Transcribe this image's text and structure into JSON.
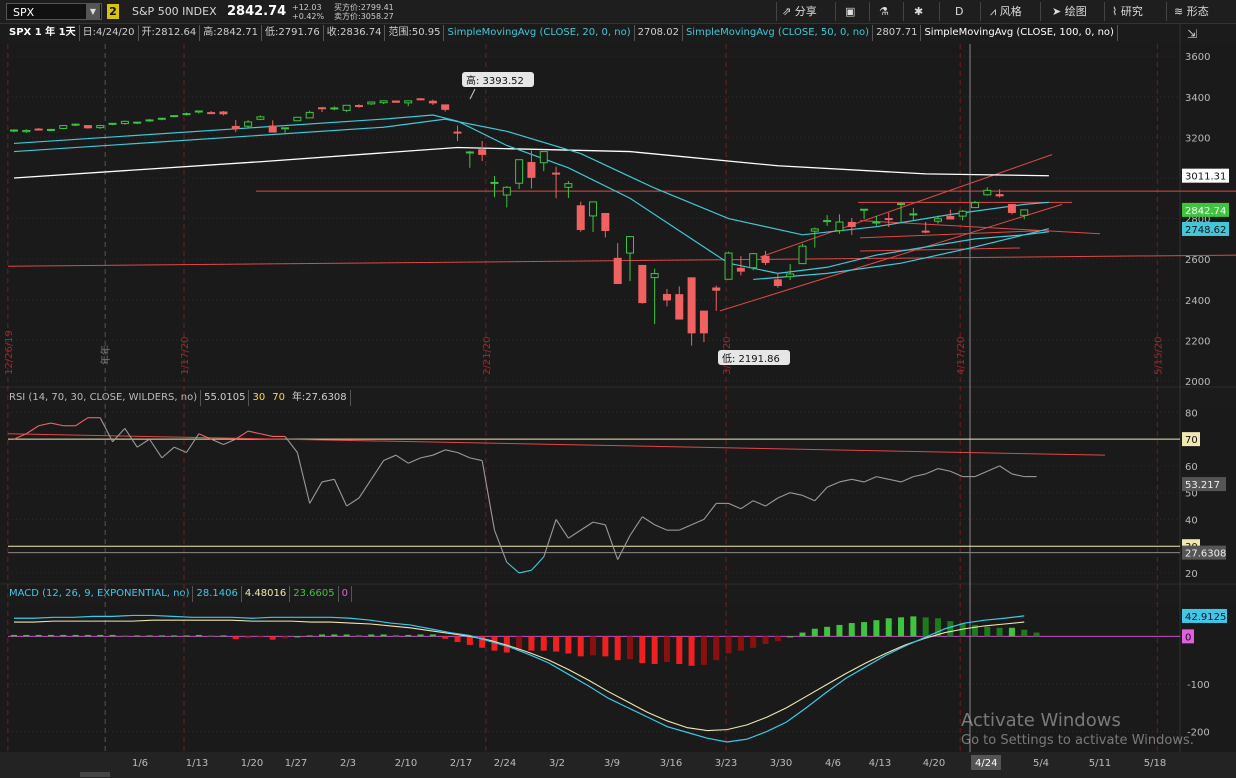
{
  "toolbar": {
    "symbol": "SPX",
    "link_badge": "2",
    "name": "S&P 500 INDEX",
    "last": "2842.74",
    "change": "+12.03",
    "change_pct": "+0.42%",
    "bid": "买方价:2799.41",
    "ask": "卖方价:3058.27",
    "share": "分享",
    "period": "D",
    "style": "风格",
    "drawing": "绘图",
    "studies": "研究",
    "patterns": "形态"
  },
  "infobar": {
    "title": "SPX 1 年 1天",
    "date": "日:4/24/20",
    "open": "开:2812.64",
    "high": "高:2842.71",
    "low": "低:2791.76",
    "close": "收:2836.74",
    "range": "范围:50.95",
    "sma20_label": "SimpleMovingAvg (CLOSE, 20, 0, no)",
    "sma20_value": "2708.02",
    "sma50_label": "SimpleMovingAvg (CLOSE, 50, 0, no)",
    "sma50_value": "2807.71",
    "sma100_label": "SimpleMovingAvg (CLOSE, 100, 0, no)"
  },
  "rsi_bar": {
    "label": "RSI (14, 70, 30, CLOSE, WILDERS, no)",
    "value": "55.0105",
    "os": "30",
    "ob": "70",
    "year": "年:27.6308"
  },
  "macd_bar": {
    "label": "MACD (12, 26, 9, EXPONENTIAL, no)",
    "value": "28.1406",
    "avg": "4.48016",
    "diff": "23.6605",
    "zero": "0"
  },
  "colors": {
    "bg": "#1b1b1b",
    "up": "#3ec43e",
    "down": "#f06262",
    "sma_cyan": "#40c8d8",
    "sma_white": "#ffffff",
    "trend": "#e04848",
    "rsi": "#9a9a9a",
    "macd": "#3ec8e8",
    "macd_avg": "#f0e8b0"
  },
  "watermark": {
    "line1": "Activate Windows",
    "line2": "Go to Settings to activate Windows."
  },
  "chart_data": [
    {
      "type": "candlestick",
      "title": "SPX 1 年 1天",
      "y_ticks": [
        2000,
        2200,
        2400,
        2600,
        2800,
        3000,
        3200,
        3400,
        3600
      ],
      "ylim": [
        1980,
        3660
      ],
      "x_tick_labels": [
        "1/6",
        "1/13",
        "1/20",
        "1/27",
        "2/3",
        "2/10",
        "2/17",
        "2/24",
        "3/2",
        "3/9",
        "3/16",
        "3/23",
        "3/30",
        "4/6",
        "4/13",
        "4/20",
        "4/24",
        "5/4",
        "5/11",
        "5/18"
      ],
      "vertical_date_labels": [
        "12/26/19",
        "1/17/20",
        "2/21/20",
        "3/20/20",
        "4/17/20",
        "5/15/20"
      ],
      "year_marker": "年年",
      "high_callout": "高: 3393.52",
      "low_callout": "低: 2191.86",
      "price_labels": [
        {
          "value": "3011.31",
          "y": 3011.31,
          "color": "#ffffff"
        },
        {
          "value": "2842.74",
          "y": 2842.74,
          "color": "#3ec43e"
        },
        {
          "value": "2748.62",
          "y": 2748.62,
          "color": "#40c8d8"
        }
      ],
      "candles": [
        [
          3235,
          3240,
          3225,
          3236
        ],
        [
          3228,
          3240,
          3222,
          3234
        ],
        [
          3241,
          3246,
          3234,
          3239
        ],
        [
          3239,
          3243,
          3233,
          3239
        ],
        [
          3244,
          3261,
          3240,
          3258
        ],
        [
          3262,
          3268,
          3255,
          3265
        ],
        [
          3258,
          3260,
          3243,
          3247
        ],
        [
          3248,
          3262,
          3242,
          3258
        ],
        [
          3267,
          3271,
          3260,
          3269
        ],
        [
          3268,
          3283,
          3262,
          3279
        ],
        [
          3274,
          3277,
          3265,
          3275
        ],
        [
          3285,
          3290,
          3277,
          3286
        ],
        [
          3294,
          3297,
          3284,
          3294
        ],
        [
          3304,
          3310,
          3300,
          3307
        ],
        [
          3316,
          3322,
          3308,
          3317
        ],
        [
          3325,
          3331,
          3317,
          3330
        ],
        [
          3322,
          3330,
          3315,
          3321
        ],
        [
          3325,
          3330,
          3308,
          3316
        ],
        [
          3254,
          3286,
          3226,
          3244
        ],
        [
          3255,
          3285,
          3248,
          3276
        ],
        [
          3289,
          3308,
          3285,
          3301
        ],
        [
          3256,
          3284,
          3226,
          3226
        ],
        [
          3242,
          3248,
          3214,
          3247
        ],
        [
          3282,
          3301,
          3280,
          3299
        ],
        [
          3296,
          3331,
          3296,
          3323
        ],
        [
          3346,
          3350,
          3325,
          3345
        ],
        [
          3344,
          3353,
          3334,
          3345
        ],
        [
          3333,
          3358,
          3324,
          3358
        ],
        [
          3357,
          3363,
          3346,
          3352
        ],
        [
          3365,
          3377,
          3360,
          3374
        ],
        [
          3371,
          3380,
          3364,
          3380
        ],
        [
          3379,
          3381,
          3371,
          3373
        ],
        [
          3370,
          3381,
          3354,
          3380
        ],
        [
          3390,
          3393,
          3382,
          3386
        ],
        [
          3378,
          3386,
          3360,
          3370
        ],
        [
          3360,
          3360,
          3327,
          3338
        ],
        [
          3226,
          3258,
          3182,
          3225
        ],
        [
          3128,
          3133,
          3050,
          3128
        ],
        [
          3139,
          3182,
          3084,
          3116
        ],
        [
          2978,
          3010,
          2906,
          2978
        ],
        [
          2916,
          2960,
          2855,
          2954
        ],
        [
          2974,
          3090,
          2946,
          3090
        ],
        [
          3076,
          3136,
          2948,
          3003
        ],
        [
          3075,
          3130,
          3034,
          3130
        ],
        [
          3024,
          3055,
          2900,
          3023
        ],
        [
          2954,
          2985,
          2901,
          2972
        ],
        [
          2863,
          2883,
          2735,
          2746
        ],
        [
          2813,
          2882,
          2734,
          2882
        ],
        [
          2825,
          2825,
          2707,
          2741
        ],
        [
          2604,
          2679,
          2478,
          2480
        ],
        [
          2630,
          2712,
          2492,
          2711
        ],
        [
          2569,
          2569,
          2381,
          2386
        ],
        [
          2509,
          2553,
          2280,
          2529
        ],
        [
          2426,
          2453,
          2367,
          2399
        ],
        [
          2425,
          2466,
          2319,
          2305
        ],
        [
          2508,
          2508,
          2174,
          2237
        ],
        [
          2344,
          2344,
          2191,
          2237
        ],
        [
          2458,
          2470,
          2345,
          2447
        ],
        [
          2501,
          2637,
          2501,
          2630
        ],
        [
          2555,
          2615,
          2520,
          2541
        ],
        [
          2558,
          2631,
          2545,
          2627
        ],
        [
          2614,
          2641,
          2571,
          2584
        ],
        [
          2498,
          2533,
          2459,
          2470
        ],
        [
          2514,
          2576,
          2497,
          2527
        ],
        [
          2578,
          2676,
          2578,
          2664
        ],
        [
          2738,
          2756,
          2657,
          2749
        ],
        [
          2785,
          2817,
          2764,
          2790
        ],
        [
          2741,
          2821,
          2725,
          2783
        ],
        [
          2781,
          2803,
          2719,
          2761
        ],
        [
          2842,
          2847,
          2797,
          2846
        ],
        [
          2780,
          2813,
          2764,
          2783
        ],
        [
          2800,
          2829,
          2758,
          2799
        ],
        [
          2869,
          2879,
          2776,
          2874
        ],
        [
          2823,
          2852,
          2793,
          2823
        ],
        [
          2738,
          2783,
          2727,
          2736
        ],
        [
          2787,
          2815,
          2775,
          2799
        ],
        [
          2810,
          2844,
          2798,
          2798
        ],
        [
          2812,
          2842,
          2791,
          2836
        ],
        [
          2854,
          2887,
          2852,
          2878
        ],
        [
          2917,
          2954,
          2912,
          2939
        ],
        [
          2918,
          2944,
          2904,
          2912
        ],
        [
          2869,
          2869,
          2821,
          2830
        ],
        [
          2816,
          2844,
          2797,
          2843
        ]
      ],
      "sma20_cyan": [
        [
          0,
          3170
        ],
        [
          30,
          3290
        ],
        [
          34,
          3310
        ],
        [
          36,
          3280
        ],
        [
          40,
          3160
        ],
        [
          45,
          3050
        ],
        [
          50,
          2900
        ],
        [
          55,
          2700
        ],
        [
          58,
          2580
        ],
        [
          62,
          2530
        ],
        [
          66,
          2560
        ],
        [
          70,
          2620
        ],
        [
          74,
          2660
        ],
        [
          78,
          2700
        ],
        [
          82,
          2720
        ],
        [
          84,
          2735
        ]
      ],
      "sma50_cyan": [
        [
          0,
          3130
        ],
        [
          30,
          3250
        ],
        [
          35,
          3290
        ],
        [
          40,
          3230
        ],
        [
          46,
          3120
        ],
        [
          52,
          2950
        ],
        [
          58,
          2800
        ],
        [
          64,
          2720
        ],
        [
          70,
          2760
        ],
        [
          76,
          2820
        ],
        [
          82,
          2870
        ],
        [
          84,
          2880
        ]
      ],
      "sma100_white": [
        [
          0,
          3000
        ],
        [
          20,
          3080
        ],
        [
          36,
          3150
        ],
        [
          50,
          3130
        ],
        [
          62,
          3060
        ],
        [
          74,
          3020
        ],
        [
          84,
          3011
        ]
      ],
      "sma_low_cyan": [
        [
          60,
          2500
        ],
        [
          66,
          2530
        ],
        [
          72,
          2580
        ],
        [
          78,
          2660
        ],
        [
          82,
          2720
        ],
        [
          84,
          2750
        ]
      ]
    },
    {
      "type": "line",
      "title": "RSI (14, 70, 30, CLOSE, WILDERS, no)",
      "y_ticks": [
        20,
        30,
        40,
        50,
        60,
        70,
        80
      ],
      "ylim": [
        17,
        82
      ],
      "price_labels": [
        {
          "value": "70",
          "y": 70
        },
        {
          "value": "53.217",
          "y": 53.2
        },
        {
          "value": "30",
          "y": 30
        },
        {
          "value": "27.6308",
          "y": 27.6
        }
      ],
      "values": [
        70,
        72,
        75,
        76,
        75,
        75,
        78,
        78,
        69,
        74,
        67,
        70,
        63,
        67,
        65,
        72,
        70,
        68,
        70,
        73,
        72,
        71,
        71,
        65,
        46,
        54,
        55,
        45,
        48,
        55,
        62,
        64,
        61,
        63,
        64,
        66,
        65,
        63,
        62,
        36,
        24,
        20,
        21,
        26,
        40,
        33,
        36,
        39,
        38,
        25,
        34,
        41,
        38,
        36,
        36,
        38,
        40,
        46,
        46,
        44,
        47,
        45,
        48,
        50,
        49,
        47,
        52,
        54,
        55,
        54,
        56,
        55,
        54,
        56,
        57,
        59,
        58,
        56,
        56,
        58,
        60,
        57,
        56,
        56
      ],
      "series": [
        {
          "name": "RSI",
          "values": "values"
        }
      ]
    },
    {
      "type": "bar+line",
      "title": "MACD (12, 26, 9, EXPONENTIAL, no)",
      "y_ticks": [
        -200,
        -100,
        0
      ],
      "ylim": [
        -243,
        68
      ],
      "price_labels": [
        {
          "value": "42.9125",
          "y": 42.9
        },
        {
          "value": "0",
          "y": 0
        }
      ],
      "histogram": [
        3,
        3,
        3,
        3,
        3,
        3,
        3,
        3,
        3,
        2,
        2,
        2,
        2,
        2,
        2,
        3,
        2,
        2,
        -6,
        -4,
        -2,
        -7,
        -4,
        0,
        2,
        4,
        4,
        4,
        3,
        4,
        4,
        3,
        3,
        4,
        4,
        -5,
        -12,
        -18,
        -24,
        -30,
        -34,
        -30,
        -30,
        -30,
        -32,
        -36,
        -42,
        -40,
        -42,
        -50,
        -48,
        -56,
        -58,
        -54,
        -58,
        -62,
        -60,
        -50,
        -36,
        -30,
        -24,
        -16,
        -10,
        0,
        8,
        16,
        20,
        24,
        28,
        30,
        34,
        38,
        40,
        42,
        40,
        38,
        32,
        28,
        24,
        20,
        18,
        18,
        14,
        8
      ],
      "macd_line": [
        38,
        38,
        40,
        40,
        42,
        42,
        44,
        44,
        42,
        40,
        40,
        40,
        38,
        40,
        40,
        40,
        40,
        38,
        34,
        28,
        24,
        16,
        8,
        2,
        -10,
        -22,
        -38,
        -56,
        -80,
        -104,
        -130,
        -150,
        -170,
        -190,
        -202,
        -214,
        -222,
        -216,
        -200,
        -180,
        -150,
        -118,
        -88,
        -64,
        -40,
        -20,
        -2,
        16,
        28,
        34,
        38,
        43
      ],
      "macd_avg": [
        30,
        30,
        32,
        32,
        32,
        32,
        32,
        34,
        34,
        34,
        34,
        34,
        32,
        32,
        32,
        30,
        30,
        28,
        26,
        22,
        18,
        12,
        6,
        0,
        -8,
        -20,
        -34,
        -50,
        -70,
        -92,
        -116,
        -138,
        -160,
        -178,
        -192,
        -198,
        -196,
        -186,
        -170,
        -150,
        -126,
        -102,
        -78,
        -56,
        -36,
        -18,
        -4,
        8,
        16,
        22,
        26,
        30
      ]
    }
  ]
}
